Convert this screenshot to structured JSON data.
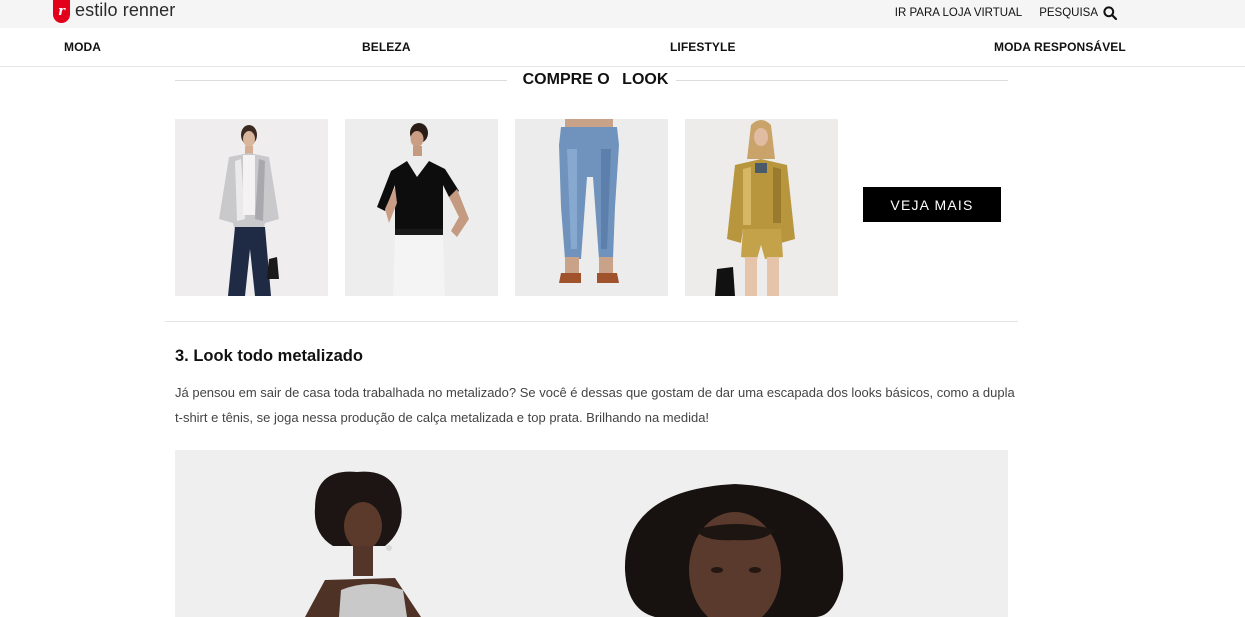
{
  "brand": {
    "name": "estilo renner",
    "mark": "r",
    "color": "#e3001b"
  },
  "topbar": {
    "store_link": "IR PARA LOJA VIRTUAL",
    "search_label": "PESQUISA",
    "search_icon": "search-icon"
  },
  "nav": {
    "items": [
      {
        "label": "MODA"
      },
      {
        "label": "BELEZA"
      },
      {
        "label": "LIFESTYLE"
      },
      {
        "label": "MODA RESPONSÁVEL"
      }
    ]
  },
  "shop_the_look": {
    "title_prefix": "COMPRE O ",
    "title_emphasis": "LOOK",
    "products": [
      {
        "alt": "Jaqueta metalizada prata"
      },
      {
        "alt": "Blusa preta decote V"
      },
      {
        "alt": "Calça jeans azul"
      },
      {
        "alt": "Conjunto dourado metalizado"
      }
    ],
    "cta_label": "VEJA MAIS"
  },
  "article": {
    "section_title": "3. Look todo metalizado",
    "paragraph": "Já pensou em sair de casa toda trabalhada no metalizado? Se você é dessas que gostam de dar uma escapada dos looks básicos, como a dupla t-shirt e tênis, se joga nessa produção de calça metalizada e top prata. Brilhando na medida!"
  }
}
